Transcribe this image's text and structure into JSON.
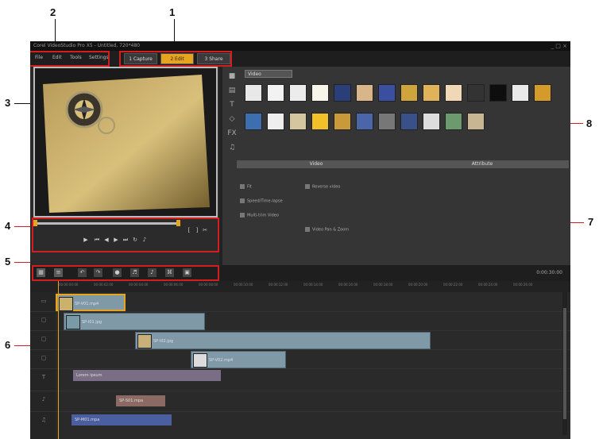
{
  "titlebar": {
    "text": "Corel VideoStudio Pro X5 - Untitled, 720*480"
  },
  "menu": {
    "items": [
      "File",
      "Edit",
      "Tools",
      "Settings"
    ]
  },
  "steps": [
    {
      "label": "1 Capture"
    },
    {
      "label": "2 Edit"
    },
    {
      "label": "3 Share"
    }
  ],
  "library": {
    "dropdown": "Video"
  },
  "options": {
    "tabs": [
      "Video",
      "Attribute"
    ],
    "items": [
      "Fit",
      "Reverse video",
      "Speed/Time-lapse",
      "Multi-trim Video",
      "Video Pan & Zoom"
    ]
  },
  "toolbar": {
    "zoom": "0:00:30:00"
  },
  "ruler": {
    "ticks": [
      "00:00:00:00",
      "00:00:02:00",
      "00:00:04:00",
      "00:00:06:00",
      "00:00:08:00",
      "00:00:10:00",
      "00:00:12:00",
      "00:00:14:00",
      "00:00:16:00",
      "00:00:18:00",
      "00:00:20:00",
      "00:00:22:00",
      "00:00:24:00",
      "00:00:26:00"
    ]
  },
  "clips": [
    {
      "label": "SP-V01.mp4"
    },
    {
      "label": "SP-I01.jpg"
    },
    {
      "label": "SP-I02.jpg"
    },
    {
      "label": "SP-V02.mp4"
    },
    {
      "label": "Lorem ipsum"
    },
    {
      "label": "SP-S01.mpa"
    },
    {
      "label": "SP-M01.mpa"
    }
  ],
  "callouts": [
    "1",
    "2",
    "3",
    "4",
    "5",
    "6",
    "7",
    "8"
  ],
  "colors": {
    "accent": "#e7a51d",
    "callout_red": "#d21e1e",
    "chrome_dark": "#1e1e1e"
  }
}
